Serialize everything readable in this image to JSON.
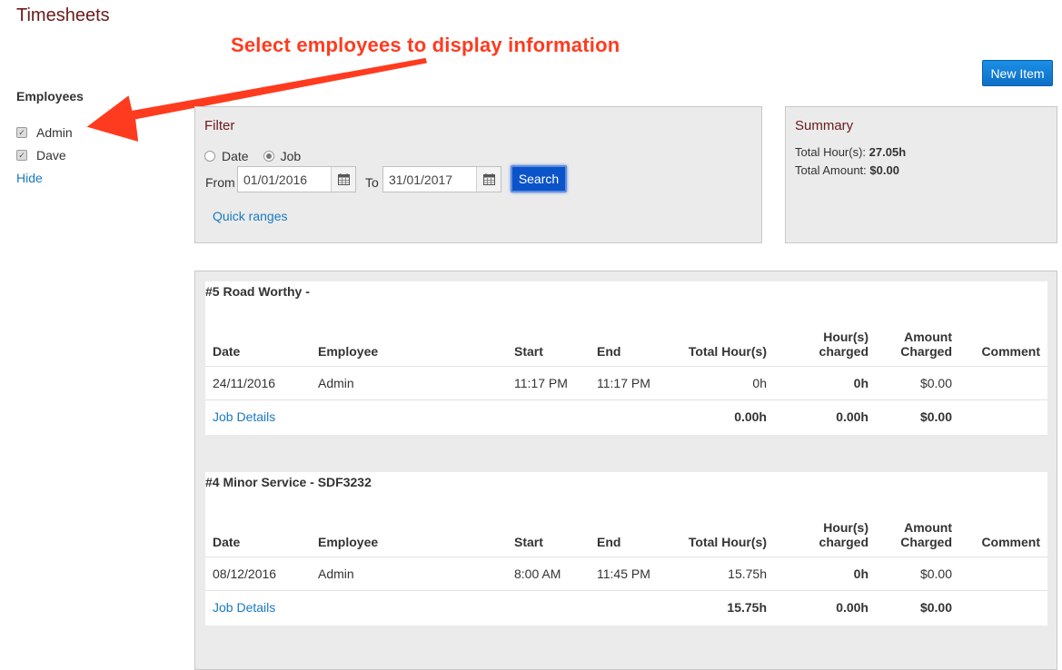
{
  "page": {
    "title": "Timesheets"
  },
  "annotation": {
    "text": "Select employees to display information",
    "color": "#ff3b1f"
  },
  "toolbar": {
    "new_item_label": "New Item"
  },
  "employees": {
    "title": "Employees",
    "items": [
      {
        "name": "Admin",
        "checked": true
      },
      {
        "name": "Dave",
        "checked": true
      }
    ],
    "hide_label": "Hide"
  },
  "filter": {
    "heading": "Filter",
    "mode_options": [
      {
        "label": "Date",
        "checked": false
      },
      {
        "label": "Job",
        "checked": true
      }
    ],
    "from_label": "From",
    "from_value": "01/01/2016",
    "to_label": "To",
    "to_value": "31/01/2017",
    "search_label": "Search",
    "quick_ranges_label": "Quick ranges"
  },
  "summary": {
    "heading": "Summary",
    "total_hours_label": "Total Hour(s):",
    "total_hours_value": "27.05h",
    "total_amount_label": "Total Amount:",
    "total_amount_value": "$0.00"
  },
  "table_headers": {
    "date": "Date",
    "employee": "Employee",
    "start": "Start",
    "end": "End",
    "total_hours": "Total Hour(s)",
    "hours_charged_1": "Hour(s)",
    "hours_charged_2": "charged",
    "amount_charged_1": "Amount",
    "amount_charged_2": "Charged",
    "comment": "Comment"
  },
  "jobs": [
    {
      "title": "#5 Road Worthy -",
      "rows": [
        {
          "date": "24/11/2016",
          "employee": "Admin",
          "start": "11:17 PM",
          "end": "11:17 PM",
          "total_hours": "0h",
          "hours_charged": "0h",
          "amount_charged": "$0.00",
          "comment": ""
        }
      ],
      "footer": {
        "link": "Job Details",
        "total_hours": "0.00h",
        "hours_charged": "0.00h",
        "amount_charged": "$0.00"
      }
    },
    {
      "title": "#4 Minor Service - SDF3232",
      "rows": [
        {
          "date": "08/12/2016",
          "employee": "Admin",
          "start": "8:00 AM",
          "end": "11:45 PM",
          "total_hours": "15.75h",
          "hours_charged": "0h",
          "amount_charged": "$0.00",
          "comment": ""
        }
      ],
      "footer": {
        "link": "Job Details",
        "total_hours": "15.75h",
        "hours_charged": "0.00h",
        "amount_charged": "$0.00"
      }
    }
  ]
}
